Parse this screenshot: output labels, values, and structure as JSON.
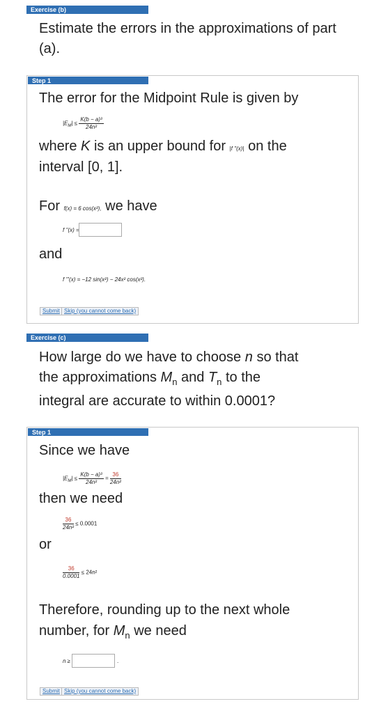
{
  "exercise_b": {
    "header": "Exercise (b)",
    "question": "Estimate the errors in the approximations of part (a).",
    "step1": {
      "header": "Step 1",
      "intro": "The error for the Midpoint Rule is given by",
      "formula_lhs": "|E",
      "formula_sub": "M",
      "formula_rhs": "| ≤",
      "formula_num": "K(b − a)³",
      "formula_den": "24n²",
      "where_a": "where",
      "where_k": "K",
      "where_b": "is an upper bound for",
      "where_fpp": "|f ''(x)|",
      "where_c": "on the",
      "interval": "interval [0, 1].",
      "for_label": "For",
      "for_func": "f(x) = 6 cos(x²),",
      "we_have": "we have",
      "fpp_label": "f ''(x) =",
      "fpp_value": "",
      "and_label": "and",
      "fppp_expr": "f '''(x) = −12 sin(x²) − 24x² cos(x²).",
      "submit_label": "Submit",
      "skip_label": "Skip (you cannot come back)"
    }
  },
  "exercise_c": {
    "header": "Exercise (c)",
    "question_a": "How large do we have to choose",
    "question_n": "n",
    "question_b": "so that",
    "question_c": "the approximations",
    "M": "M",
    "sub_n": "n",
    "and": "and",
    "T": "T",
    "question_d": "to the",
    "question_e": "integral are accurate to within 0.0001?",
    "step1": {
      "header": "Step 1",
      "since": "Since we have",
      "ineq_lhs": "|E",
      "ineq_sub": "M",
      "ineq_le": "| ≤",
      "ineq_num": "K(b − a)³",
      "ineq_den": "24n²",
      "eq": "=",
      "red_num": "36",
      "red_den": "24n²",
      "then": "then we need",
      "need_num": "36",
      "need_den": "24n²",
      "need_rhs": "≤ 0.0001",
      "or_label": "or",
      "or_num": "36",
      "or_den": "0.0001",
      "or_rhs": "≤ 24n²",
      "therefore_a": "Therefore, rounding up to the next whole",
      "therefore_b": "number, for",
      "therefore_M": "M",
      "therefore_sub": "n",
      "therefore_c": "we need",
      "n_label": "n ≥",
      "n_value": "",
      "period": ".",
      "submit_label": "Submit",
      "skip_label": "Skip (you cannot come back)"
    }
  }
}
